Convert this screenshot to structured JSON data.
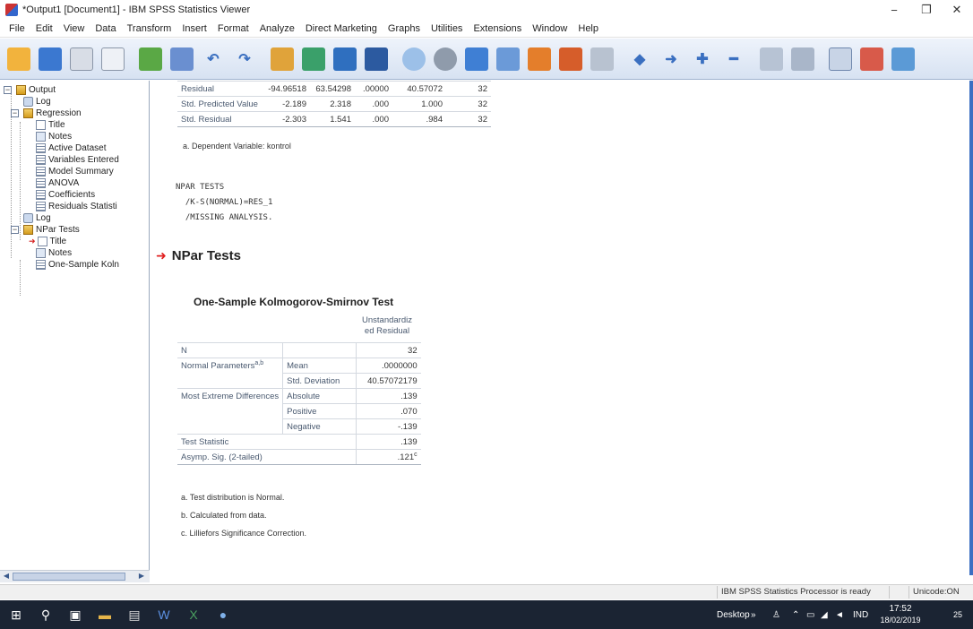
{
  "window": {
    "title": "*Output1 [Document1] - IBM SPSS Statistics Viewer",
    "minimize_glyph": "−",
    "maximize_glyph": "❐",
    "close_glyph": "✕"
  },
  "menu": [
    "File",
    "Edit",
    "View",
    "Data",
    "Transform",
    "Insert",
    "Format",
    "Analyze",
    "Direct Marketing",
    "Graphs",
    "Utilities",
    "Extensions",
    "Window",
    "Help"
  ],
  "toolbar": {
    "icons": [
      "open-folder-icon",
      "save-icon",
      "print-icon",
      "print-preview-icon",
      "export-icon",
      "recall-dialog-icon",
      "undo-icon",
      "redo-icon",
      "goto-data-icon",
      "goto-case-icon",
      "variables-icon",
      "find-icon",
      "chart-builder-icon",
      "designate-window-icon",
      "run-icon",
      "insert-case-icon",
      "insert-variable-icon",
      "split-icon",
      "select-cases-icon",
      "previous-icon",
      "next-icon",
      "promote-icon",
      "demote-icon",
      "expand-icon",
      "collapse-icon",
      "show-icon",
      "hide-icon",
      "insert-heading-icon"
    ]
  },
  "outline": {
    "items": [
      {
        "label": "Output",
        "icon": "book-icon",
        "expander": "−"
      },
      {
        "label": "Log",
        "icon": "log-icon"
      },
      {
        "label": "Regression",
        "icon": "book-icon",
        "expander": "−"
      },
      {
        "label": "Title",
        "icon": "title-icon"
      },
      {
        "label": "Notes",
        "icon": "notes-icon"
      },
      {
        "label": "Active Dataset",
        "icon": "table-icon"
      },
      {
        "label": "Variables Entered",
        "icon": "table-icon"
      },
      {
        "label": "Model Summary",
        "icon": "table-icon"
      },
      {
        "label": "ANOVA",
        "icon": "table-icon"
      },
      {
        "label": "Coefficients",
        "icon": "table-icon"
      },
      {
        "label": "Residuals Statisti",
        "icon": "table-icon"
      },
      {
        "label": "Log",
        "icon": "log-icon"
      },
      {
        "label": "NPar Tests",
        "icon": "book-icon",
        "expander": "−"
      },
      {
        "label": "Title",
        "icon": "title-icon",
        "selected": true
      },
      {
        "label": "Notes",
        "icon": "notes-icon"
      },
      {
        "label": "One-Sample Koln",
        "icon": "table-icon"
      }
    ]
  },
  "residuals_table": {
    "rows": [
      [
        "Residual",
        "-94.96518",
        "63.54298",
        ".00000",
        "40.57072",
        "32"
      ],
      [
        "Std. Predicted Value",
        "-2.189",
        "2.318",
        ".000",
        "1.000",
        "32"
      ],
      [
        "Std. Residual",
        "-2.303",
        "1.541",
        ".000",
        ".984",
        "32"
      ]
    ],
    "footnote": "a. Dependent Variable: kontrol"
  },
  "syntax": {
    "lines": [
      "NPAR TESTS",
      "  /K-S(NORMAL)=RES_1",
      "  /MISSING ANALYSIS."
    ]
  },
  "npar": {
    "heading": "NPar Tests",
    "table_title": "One-Sample Kolmogorov-Smirnov Test",
    "column_header_line1": "Unstandardiz",
    "column_header_line2": "ed Residual",
    "rows": [
      {
        "label": "N",
        "sub": "",
        "value": "32"
      },
      {
        "label": "Normal Parameters",
        "label_sup": "a,b",
        "sub": "Mean",
        "value": ".0000000"
      },
      {
        "label": "",
        "sub": "Std. Deviation",
        "value": "40.57072179"
      },
      {
        "label": "Most Extreme Differences",
        "sub": "Absolute",
        "value": ".139"
      },
      {
        "label": "",
        "sub": "Positive",
        "value": ".070"
      },
      {
        "label": "",
        "sub": "Negative",
        "value": "-.139"
      },
      {
        "label": "Test Statistic",
        "sub": "",
        "value": ".139"
      },
      {
        "label": "Asymp. Sig. (2-tailed)",
        "sub": "",
        "value": ".121",
        "value_sup": "c"
      }
    ],
    "footnotes": [
      "a. Test distribution is Normal.",
      "b. Calculated from data.",
      "c. Lilliefors Significance Correction."
    ]
  },
  "status": {
    "processor": "IBM SPSS Statistics Processor is ready",
    "unicode": "Unicode:ON"
  },
  "taskbar": {
    "desktop": "Desktop",
    "chevron": "»",
    "language": "IND",
    "time": "17:52",
    "date": "18/02/2019",
    "notifications": "25"
  }
}
